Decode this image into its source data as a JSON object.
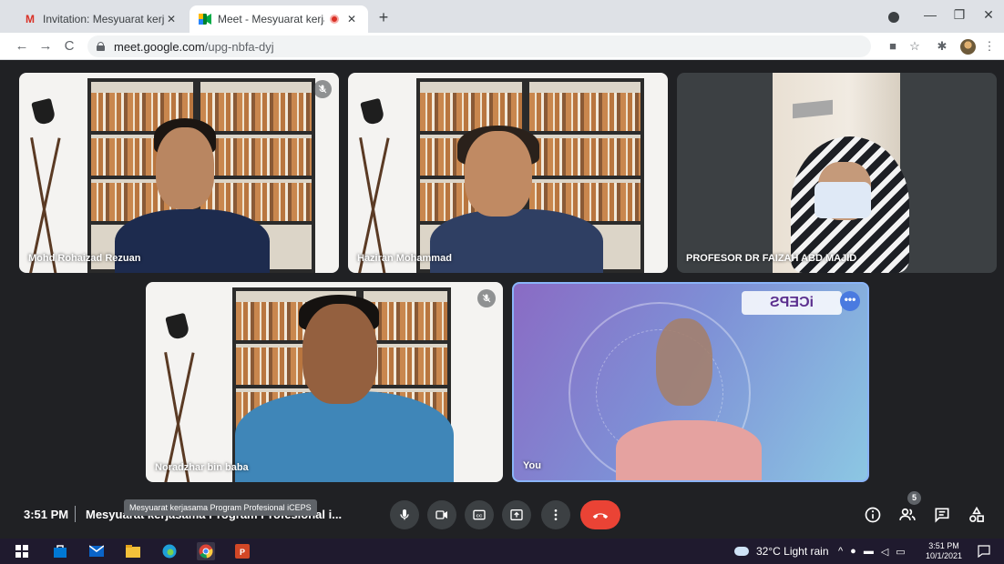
{
  "browser": {
    "tabs": [
      {
        "title": "Invitation: Mesyuarat kerjasama",
        "favicon": "gmail-icon",
        "active": false
      },
      {
        "title": "Meet - Mesyuarat kerjasama",
        "favicon": "meet-icon",
        "active": true
      }
    ],
    "new_tab": "+",
    "url_host": "meet.google.com",
    "url_path": "/upg-nbfa-dyj",
    "colors": {
      "tabbar": "#dee1e6",
      "gmail_red": "#d93025"
    }
  },
  "meet": {
    "participants": [
      {
        "name": "Mohd Rohaizad Rezuan",
        "muted": true
      },
      {
        "name": "Haziran Mohammad",
        "muted": false
      },
      {
        "name": "PROFESOR DR FAIZAH ABD MAJID",
        "muted": false
      },
      {
        "name": "Noradzhar bin baba",
        "muted": true
      },
      {
        "name": "You",
        "muted": false
      }
    ],
    "self_view_banner": "iCEPS",
    "clock": "3:51 PM",
    "meeting_title": "Mesyuarat kerjasama Program Profesional i...",
    "tooltip": "Mesyuarat kerjasama Program Profesional iCEPS",
    "participant_count": "5",
    "colors": {
      "stage": "#202124",
      "end_call": "#ea4335",
      "control": "#3c4043",
      "self_border": "#8ab4f8"
    }
  },
  "taskbar": {
    "weather": "32°C  Light rain",
    "time": "3:51 PM",
    "date": "10/1/2021"
  }
}
